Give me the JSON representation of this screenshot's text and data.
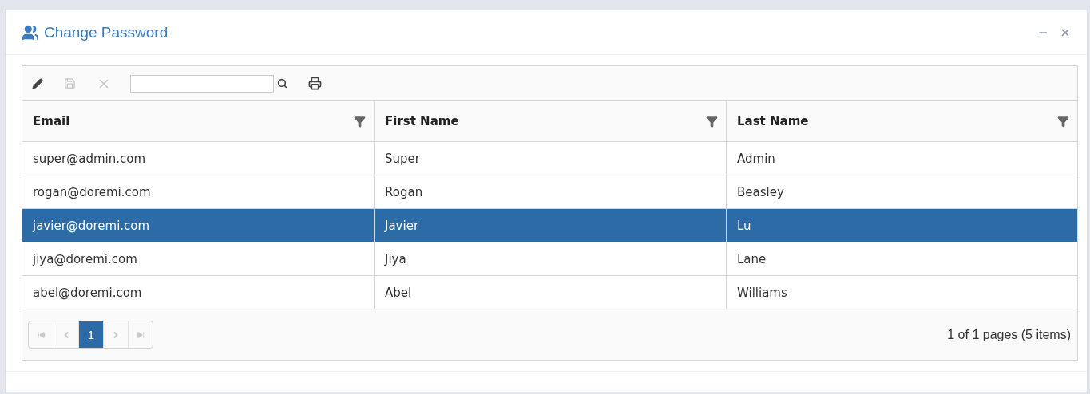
{
  "window": {
    "title": "Change Password"
  },
  "columns": [
    {
      "label": "Email"
    },
    {
      "label": "First Name"
    },
    {
      "label": "Last Name"
    }
  ],
  "rows": [
    {
      "cells": [
        "super@admin.com",
        "Super",
        "Admin"
      ],
      "selected": false
    },
    {
      "cells": [
        "rogan@doremi.com",
        "Rogan",
        "Beasley"
      ],
      "selected": false
    },
    {
      "cells": [
        "javier@doremi.com",
        "Javier",
        "Lu"
      ],
      "selected": true
    },
    {
      "cells": [
        "jiya@doremi.com",
        "Jiya",
        "Lane"
      ],
      "selected": false
    },
    {
      "cells": [
        "abel@doremi.com",
        "Abel",
        "Williams"
      ],
      "selected": false
    }
  ],
  "pager": {
    "pages": [
      {
        "label": "1",
        "selected": true
      }
    ],
    "summary": "1 of 1 pages (5 items)"
  }
}
